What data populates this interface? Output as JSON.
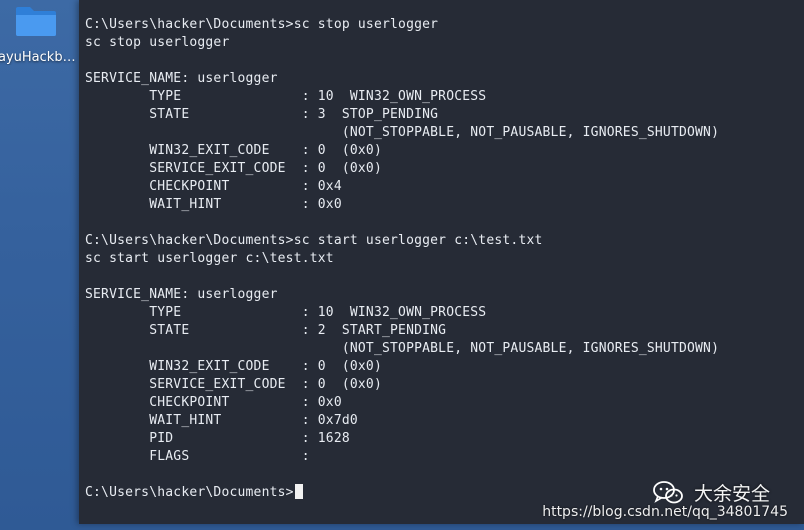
{
  "desktop": {
    "folder_label": "ayuHackba..."
  },
  "terminal": {
    "lines": [
      "C:\\Users\\hacker\\Documents>sc stop userlogger",
      "sc stop userlogger",
      "",
      "SERVICE_NAME: userlogger",
      "        TYPE               : 10  WIN32_OWN_PROCESS",
      "        STATE              : 3  STOP_PENDING",
      "                                (NOT_STOPPABLE, NOT_PAUSABLE, IGNORES_SHUTDOWN)",
      "        WIN32_EXIT_CODE    : 0  (0x0)",
      "        SERVICE_EXIT_CODE  : 0  (0x0)",
      "        CHECKPOINT         : 0x4",
      "        WAIT_HINT          : 0x0",
      "",
      "C:\\Users\\hacker\\Documents>sc start userlogger c:\\test.txt",
      "sc start userlogger c:\\test.txt",
      "",
      "SERVICE_NAME: userlogger",
      "        TYPE               : 10  WIN32_OWN_PROCESS",
      "        STATE              : 2  START_PENDING",
      "                                (NOT_STOPPABLE, NOT_PAUSABLE, IGNORES_SHUTDOWN)",
      "        WIN32_EXIT_CODE    : 0  (0x0)",
      "        SERVICE_EXIT_CODE  : 0  (0x0)",
      "        CHECKPOINT         : 0x0",
      "        WAIT_HINT          : 0x7d0",
      "        PID                : 1628",
      "        FLAGS              :",
      ""
    ],
    "prompt": "C:\\Users\\hacker\\Documents>"
  },
  "watermark": {
    "brand": "大余安全",
    "url": "https://blog.csdn.net/qq_34801745"
  },
  "colors": {
    "desktop_bg": "#3a67a2",
    "terminal_bg": "#262b36",
    "terminal_fg": "#e8ecf2",
    "folder": "#3d8ee8"
  },
  "icons": {
    "folder": "folder-icon",
    "wechat": "wechat-logo-icon"
  }
}
